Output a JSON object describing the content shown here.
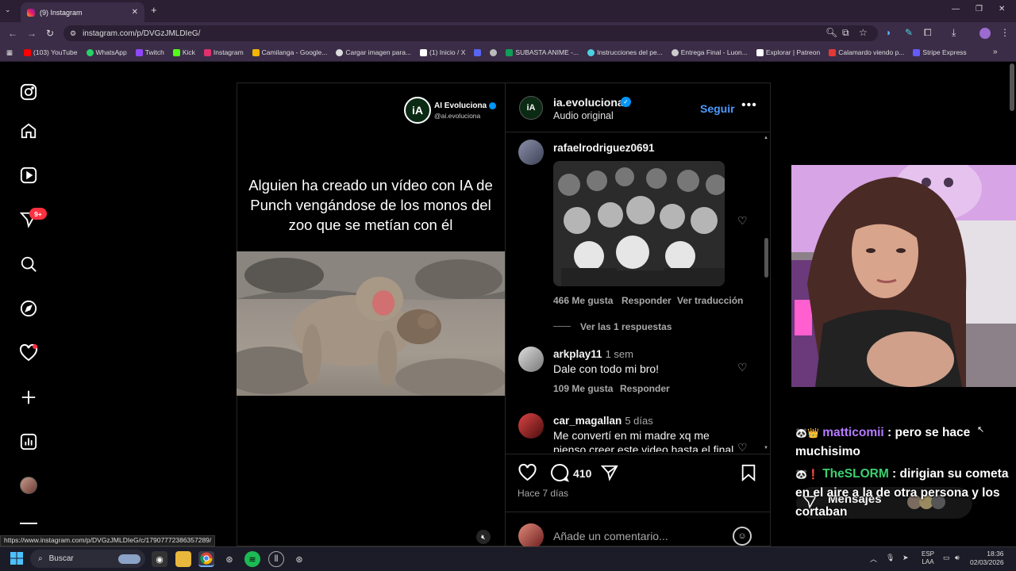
{
  "browser": {
    "tab_title": "(9) Instagram",
    "url": "instagram.com/p/DVGzJMLDIeG/",
    "status_url": "https://www.instagram.com/p/DVGzJMLDIeG/c/17907772386357289/",
    "bookmarks": [
      {
        "label": "(103) YouTube",
        "color": "#ff0000"
      },
      {
        "label": "WhatsApp",
        "color": "#25d366"
      },
      {
        "label": "Twitch",
        "color": "#9146ff"
      },
      {
        "label": "Kick",
        "color": "#53fc18"
      },
      {
        "label": "Instagram",
        "color": "#e1306c"
      },
      {
        "label": "Camilanga - Google...",
        "color": "#f4b400"
      },
      {
        "label": "Cargar imagen para...",
        "color": "#dddddd"
      },
      {
        "label": "(1) Inicio / X",
        "color": "#ffffff"
      },
      {
        "label": "",
        "color": "#5865f2"
      },
      {
        "label": "",
        "color": "#bbbbbb"
      },
      {
        "label": "SUBASTA ANIME -...",
        "color": "#0f9d58"
      },
      {
        "label": "Instrucciones del pe...",
        "color": "#4dd0e1"
      },
      {
        "label": "Entrega Final - Luon...",
        "color": "#cccccc"
      },
      {
        "label": "Explorar | Patreon",
        "color": "#ffffff"
      },
      {
        "label": "Calamardo viendo p...",
        "color": "#e53935"
      },
      {
        "label": "Stripe Express",
        "color": "#635bff"
      }
    ]
  },
  "sidebar": {
    "notifications_badge": "9+"
  },
  "post": {
    "overlay_name": "AI Evoluciona",
    "overlay_handle": "@ai.evoluciona",
    "caption": "Alguien ha creado un vídeo con IA de Punch vengándose de los monos del zoo que se metían con él",
    "account": "ia.evoluciona",
    "audio": "Audio original",
    "follow_label": "Seguir",
    "logo_text": "iA",
    "comment_count": "410",
    "time_ago": "Hace 7 días",
    "comment_placeholder": "Añade un comentario..."
  },
  "comments": [
    {
      "user": "rafaelrodriguez0691",
      "time": "",
      "text": "",
      "likes": "466 Me gusta",
      "reply": "Responder",
      "translate": "Ver traducción",
      "replies": "Ver las 1 respuestas"
    },
    {
      "user": "arkplay11",
      "time": "1 sem",
      "text": "Dale con todo mi bro!",
      "likes": "109 Me gusta",
      "reply": "Responder"
    },
    {
      "user": "car_magallan",
      "time": "5 días",
      "text": "Me convertí en mi madre xq me pienso creer este video hasta el final"
    }
  ],
  "stream_chat": [
    {
      "user": "matticomii",
      "color": "#b57bff",
      "text": ": pero se hace muchisimo"
    },
    {
      "user": "TheSLORM",
      "color": "#3cd070",
      "text": ": dirigian su cometa en el aire a la de otra persona y los cortaban"
    }
  ],
  "messages_label": "Mensajes",
  "taskbar": {
    "search_label": "Buscar",
    "lang": "ESP",
    "lang2": "LAA",
    "time": "18:36",
    "date": "02/03/2026"
  }
}
